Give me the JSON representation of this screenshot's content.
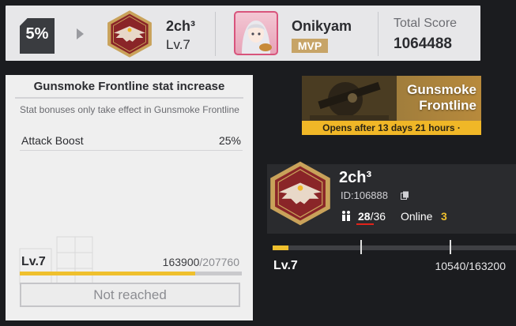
{
  "top_banner": {
    "rank_percent": "5%",
    "guild_name": "2ch³",
    "guild_level": "Lv.7",
    "mvp_name": "Onikyam",
    "mvp_badge": "MVP",
    "total_score_label": "Total Score",
    "total_score_value": "1064488"
  },
  "stat_card": {
    "title": "Gunsmoke Frontline stat increase",
    "description": "Stat bonuses only take effect in Gunsmoke Frontline",
    "attack_label": "Attack Boost",
    "attack_value": "25%",
    "level": "Lv.7",
    "exp_current": "163900",
    "exp_sep": "/",
    "exp_total": "207760",
    "progress": 0.789,
    "button_label": "Not reached"
  },
  "event_banner": {
    "title": "Gunsmoke Frontline",
    "footer": "Opens after 13 days 21 hours ·"
  },
  "guild_panel": {
    "name": "2ch³",
    "id": "ID:106888",
    "members_current": "28",
    "members_total": "/36",
    "online_label": "Online",
    "online_count": "3"
  },
  "right_progress": {
    "level": "Lv.7",
    "exp": "10540/163200",
    "progress": 0.064
  },
  "colors": {
    "accent_yellow": "#efc02d",
    "emblem_red": "#8a2528",
    "emblem_gold": "#c9a25a",
    "mvp_gold": "#c7a467",
    "underline_red": "#e2231a"
  },
  "icons": [
    "arrow-right-icon",
    "guild-emblem-icon",
    "mvp-avatar-icon",
    "copy-icon",
    "members-icon"
  ]
}
